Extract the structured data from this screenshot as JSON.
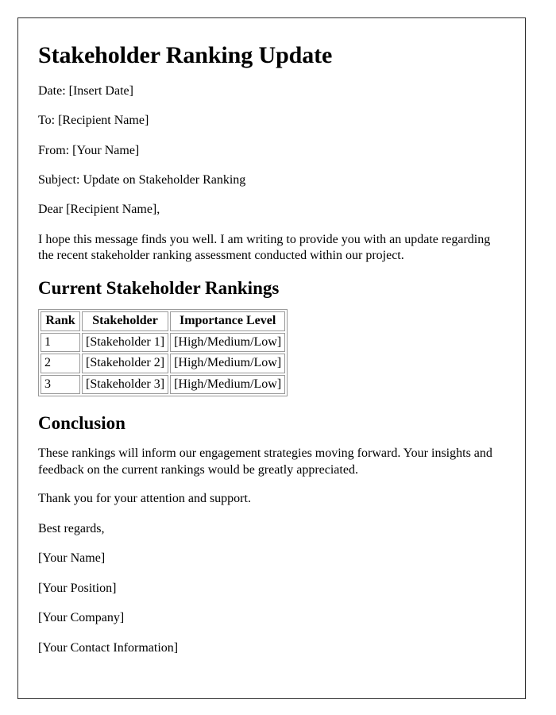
{
  "document": {
    "title": "Stakeholder Ranking Update",
    "meta": [
      "Date: [Insert Date]",
      "To: [Recipient Name]",
      "From: [Your Name]",
      "Subject: Update on Stakeholder Ranking"
    ],
    "greeting": "Dear [Recipient Name],",
    "intro_paragraph": "I hope this message finds you well. I am writing to provide you with an update regarding the recent stakeholder ranking assessment conducted within our project.",
    "rankings_section": {
      "heading": "Current Stakeholder Rankings",
      "table": {
        "columns": [
          "Rank",
          "Stakeholder",
          "Importance Level"
        ],
        "rows": [
          [
            "1",
            "[Stakeholder 1]",
            "[High/Medium/Low]"
          ],
          [
            "2",
            "[Stakeholder 2]",
            "[High/Medium/Low]"
          ],
          [
            "3",
            "[Stakeholder 3]",
            "[High/Medium/Low]"
          ]
        ]
      }
    },
    "conclusion_section": {
      "heading": "Conclusion",
      "paragraph": "These rankings will inform our engagement strategies moving forward. Your insights and feedback on the current rankings would be greatly appreciated.",
      "thanks": "Thank you for your attention and support."
    },
    "signature": {
      "closing": "Best regards,",
      "lines": [
        "[Your Name]",
        "[Your Position]",
        "[Your Company]",
        "[Your Contact Information]"
      ]
    }
  },
  "colors": {
    "page_border": "#2e2e2e",
    "text": "#000000",
    "table_border": "#9a9a9a",
    "background": "#ffffff"
  }
}
